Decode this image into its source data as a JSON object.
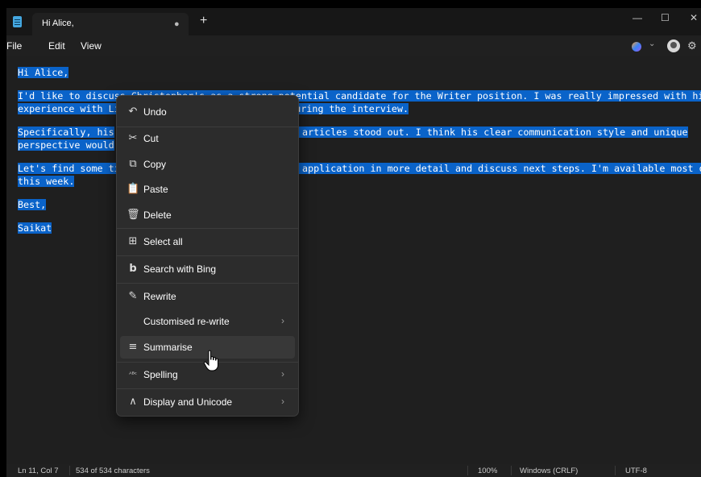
{
  "titlebar": {
    "tab_title": "Hi Alice,",
    "modified_dot": "●",
    "new_tab": "+",
    "minimize": "—",
    "maximize": "☐",
    "close": "✕"
  },
  "menubar": {
    "file": "File",
    "edit": "Edit",
    "view": "View",
    "copilot_caret": "⌄",
    "settings_icon": "⚙"
  },
  "editor": {
    "lines": [
      "Hi Alice,",
      "I'd like to discuss Christopher's as a strong potential candidate for the Writer position. I was really impressed with his",
      "experience with Li",
      "nswers during the interview.",
      "Specifically, his",
      " articles stood out. I think his clear communication style and unique",
      "perspective would",
      "Let's find some ti",
      " application in more detail and discuss next steps. I'm available most of",
      "this week.",
      "Best,",
      "Saikat"
    ]
  },
  "context_menu": {
    "items": [
      {
        "label": "Undo",
        "icon": "↶",
        "icon_name": "undo-icon"
      },
      {
        "label": "Cut",
        "icon": "✂",
        "icon_name": "scissors-icon"
      },
      {
        "label": "Copy",
        "icon": "⧉",
        "icon_name": "copy-icon"
      },
      {
        "label": "Paste",
        "icon": "📋",
        "icon_name": "paste-icon"
      },
      {
        "label": "Delete",
        "icon": "🗑",
        "icon_name": "trash-icon"
      },
      {
        "label": "Select all",
        "icon": "⊞",
        "icon_name": "select-all-icon"
      },
      {
        "label": "Search with Bing",
        "icon": "b",
        "icon_name": "bing-icon"
      },
      {
        "label": "Rewrite",
        "icon": "✎",
        "icon_name": "rewrite-icon"
      },
      {
        "label": "Customised re-write",
        "icon": "",
        "icon_name": ""
      },
      {
        "label": "Summarise",
        "icon": "≡",
        "icon_name": "summarise-icon"
      },
      {
        "label": "Spelling",
        "icon": "ᴬᴮᶜ",
        "icon_name": "spelling-icon"
      },
      {
        "label": "Display and Unicode",
        "icon": "∧",
        "icon_name": "unicode-icon"
      }
    ],
    "submenu_arrow": "›"
  },
  "status": {
    "position": "Ln 11, Col 7",
    "chars": "534 of 534 characters",
    "zoom": "100%",
    "line_ending": "Windows (CRLF)",
    "encoding": "UTF-8"
  }
}
